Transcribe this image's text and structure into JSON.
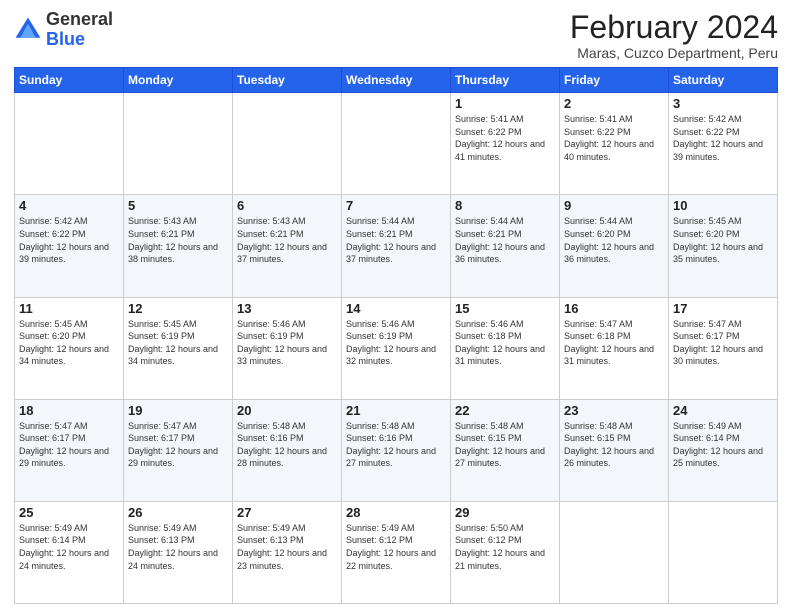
{
  "logo": {
    "text_general": "General",
    "text_blue": "Blue"
  },
  "header": {
    "month_title": "February 2024",
    "subtitle": "Maras, Cuzco Department, Peru"
  },
  "days_of_week": [
    "Sunday",
    "Monday",
    "Tuesday",
    "Wednesday",
    "Thursday",
    "Friday",
    "Saturday"
  ],
  "weeks": [
    [
      {
        "day": "",
        "info": ""
      },
      {
        "day": "",
        "info": ""
      },
      {
        "day": "",
        "info": ""
      },
      {
        "day": "",
        "info": ""
      },
      {
        "day": "1",
        "info": "Sunrise: 5:41 AM\nSunset: 6:22 PM\nDaylight: 12 hours and 41 minutes."
      },
      {
        "day": "2",
        "info": "Sunrise: 5:41 AM\nSunset: 6:22 PM\nDaylight: 12 hours and 40 minutes."
      },
      {
        "day": "3",
        "info": "Sunrise: 5:42 AM\nSunset: 6:22 PM\nDaylight: 12 hours and 39 minutes."
      }
    ],
    [
      {
        "day": "4",
        "info": "Sunrise: 5:42 AM\nSunset: 6:22 PM\nDaylight: 12 hours and 39 minutes."
      },
      {
        "day": "5",
        "info": "Sunrise: 5:43 AM\nSunset: 6:21 PM\nDaylight: 12 hours and 38 minutes."
      },
      {
        "day": "6",
        "info": "Sunrise: 5:43 AM\nSunset: 6:21 PM\nDaylight: 12 hours and 37 minutes."
      },
      {
        "day": "7",
        "info": "Sunrise: 5:44 AM\nSunset: 6:21 PM\nDaylight: 12 hours and 37 minutes."
      },
      {
        "day": "8",
        "info": "Sunrise: 5:44 AM\nSunset: 6:21 PM\nDaylight: 12 hours and 36 minutes."
      },
      {
        "day": "9",
        "info": "Sunrise: 5:44 AM\nSunset: 6:20 PM\nDaylight: 12 hours and 36 minutes."
      },
      {
        "day": "10",
        "info": "Sunrise: 5:45 AM\nSunset: 6:20 PM\nDaylight: 12 hours and 35 minutes."
      }
    ],
    [
      {
        "day": "11",
        "info": "Sunrise: 5:45 AM\nSunset: 6:20 PM\nDaylight: 12 hours and 34 minutes."
      },
      {
        "day": "12",
        "info": "Sunrise: 5:45 AM\nSunset: 6:19 PM\nDaylight: 12 hours and 34 minutes."
      },
      {
        "day": "13",
        "info": "Sunrise: 5:46 AM\nSunset: 6:19 PM\nDaylight: 12 hours and 33 minutes."
      },
      {
        "day": "14",
        "info": "Sunrise: 5:46 AM\nSunset: 6:19 PM\nDaylight: 12 hours and 32 minutes."
      },
      {
        "day": "15",
        "info": "Sunrise: 5:46 AM\nSunset: 6:18 PM\nDaylight: 12 hours and 31 minutes."
      },
      {
        "day": "16",
        "info": "Sunrise: 5:47 AM\nSunset: 6:18 PM\nDaylight: 12 hours and 31 minutes."
      },
      {
        "day": "17",
        "info": "Sunrise: 5:47 AM\nSunset: 6:17 PM\nDaylight: 12 hours and 30 minutes."
      }
    ],
    [
      {
        "day": "18",
        "info": "Sunrise: 5:47 AM\nSunset: 6:17 PM\nDaylight: 12 hours and 29 minutes."
      },
      {
        "day": "19",
        "info": "Sunrise: 5:47 AM\nSunset: 6:17 PM\nDaylight: 12 hours and 29 minutes."
      },
      {
        "day": "20",
        "info": "Sunrise: 5:48 AM\nSunset: 6:16 PM\nDaylight: 12 hours and 28 minutes."
      },
      {
        "day": "21",
        "info": "Sunrise: 5:48 AM\nSunset: 6:16 PM\nDaylight: 12 hours and 27 minutes."
      },
      {
        "day": "22",
        "info": "Sunrise: 5:48 AM\nSunset: 6:15 PM\nDaylight: 12 hours and 27 minutes."
      },
      {
        "day": "23",
        "info": "Sunrise: 5:48 AM\nSunset: 6:15 PM\nDaylight: 12 hours and 26 minutes."
      },
      {
        "day": "24",
        "info": "Sunrise: 5:49 AM\nSunset: 6:14 PM\nDaylight: 12 hours and 25 minutes."
      }
    ],
    [
      {
        "day": "25",
        "info": "Sunrise: 5:49 AM\nSunset: 6:14 PM\nDaylight: 12 hours and 24 minutes."
      },
      {
        "day": "26",
        "info": "Sunrise: 5:49 AM\nSunset: 6:13 PM\nDaylight: 12 hours and 24 minutes."
      },
      {
        "day": "27",
        "info": "Sunrise: 5:49 AM\nSunset: 6:13 PM\nDaylight: 12 hours and 23 minutes."
      },
      {
        "day": "28",
        "info": "Sunrise: 5:49 AM\nSunset: 6:12 PM\nDaylight: 12 hours and 22 minutes."
      },
      {
        "day": "29",
        "info": "Sunrise: 5:50 AM\nSunset: 6:12 PM\nDaylight: 12 hours and 21 minutes."
      },
      {
        "day": "",
        "info": ""
      },
      {
        "day": "",
        "info": ""
      }
    ]
  ]
}
